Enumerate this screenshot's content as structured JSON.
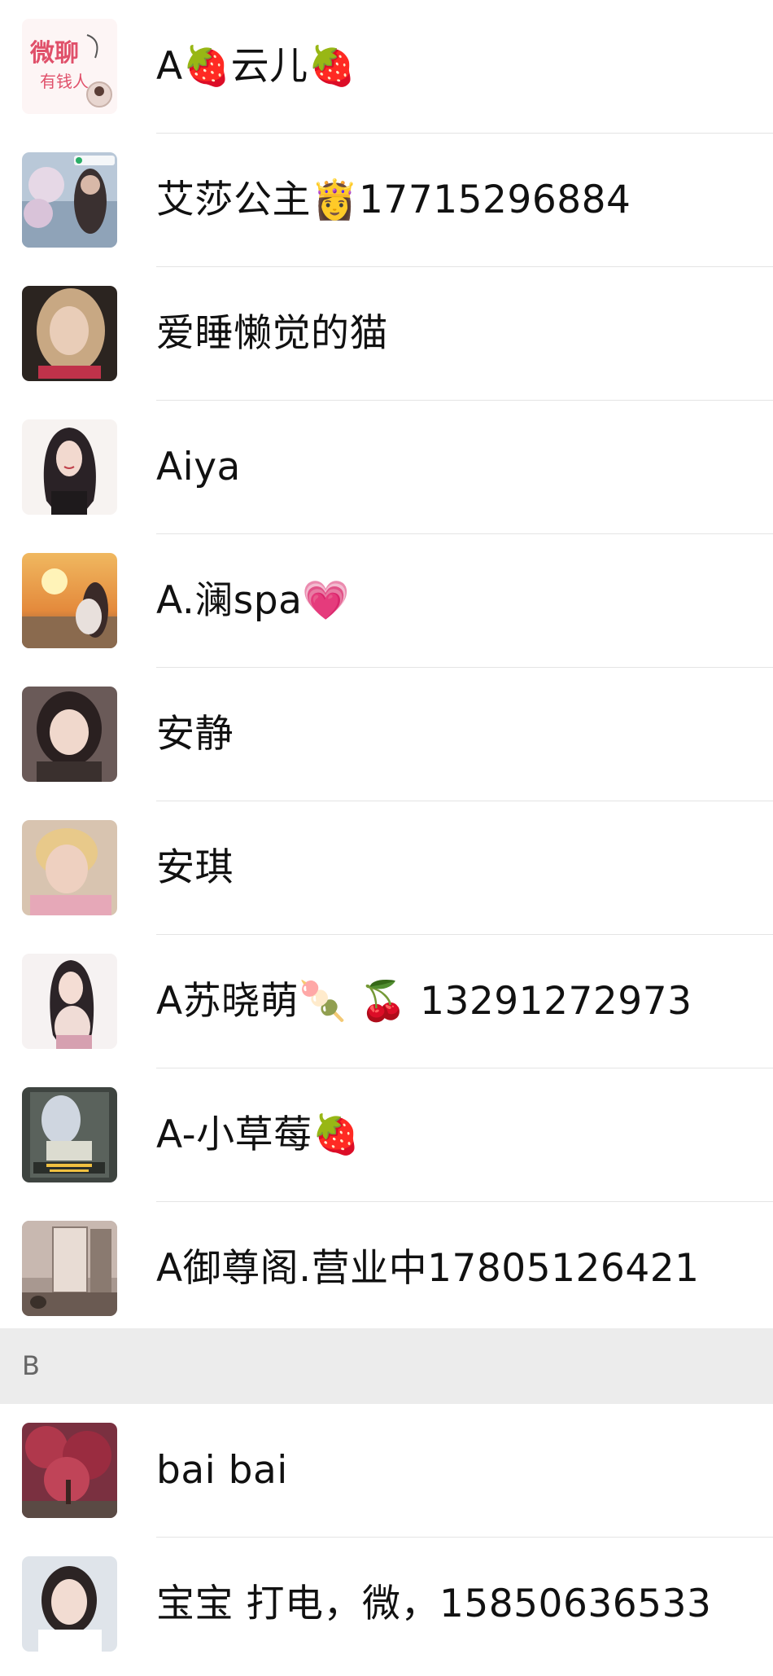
{
  "contacts_a": [
    {
      "name": "A🍓云儿🍓",
      "avatar_icon": "sticker-avatar"
    },
    {
      "name": "艾莎公主👸17715296884",
      "avatar_icon": "photo-avatar"
    },
    {
      "name": "爱睡懒觉的猫",
      "avatar_icon": "photo-avatar"
    },
    {
      "name": "Aiya",
      "avatar_icon": "illustration-avatar"
    },
    {
      "name": "A.澜spa💗",
      "avatar_icon": "sunset-photo-avatar"
    },
    {
      "name": "安静",
      "avatar_icon": "photo-avatar"
    },
    {
      "name": "安琪",
      "avatar_icon": "photo-avatar"
    },
    {
      "name": "A苏晓萌🍡 🍒 13291272973",
      "avatar_icon": "illustration-avatar"
    },
    {
      "name": "A-小草莓🍓",
      "avatar_icon": "photo-avatar"
    },
    {
      "name": "A御尊阁.营业中17805126421",
      "avatar_icon": "room-photo-avatar"
    }
  ],
  "section_b": {
    "letter": "B",
    "contacts": [
      {
        "name": "bai bai",
        "avatar_icon": "tree-photo-avatar"
      },
      {
        "name": "宝宝 打电，微，15850636533",
        "avatar_icon": "photo-avatar"
      }
    ]
  },
  "colors": {
    "background": "#ffffff",
    "section_header": "#ececec",
    "divider": "#e4e4e4",
    "text": "#111111"
  }
}
